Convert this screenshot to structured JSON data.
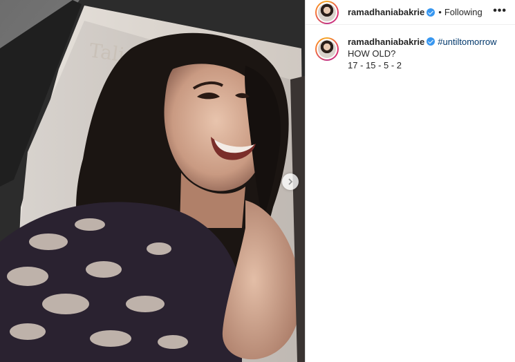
{
  "post": {
    "username": "ramadhaniabakrie",
    "follow_status": "Following",
    "more_icon": "more-horizontal-icon"
  },
  "caption": {
    "username": "ramadhaniabakrie",
    "hashtag": "#untiltomorrow",
    "lines": [
      "HOW OLD?",
      "17 - 15 - 5 - 2"
    ]
  },
  "media": {
    "magazine_header_text": "Tali"
  },
  "colors": {
    "link": "#00376b",
    "verified": "#3897f0",
    "text": "#262626"
  }
}
